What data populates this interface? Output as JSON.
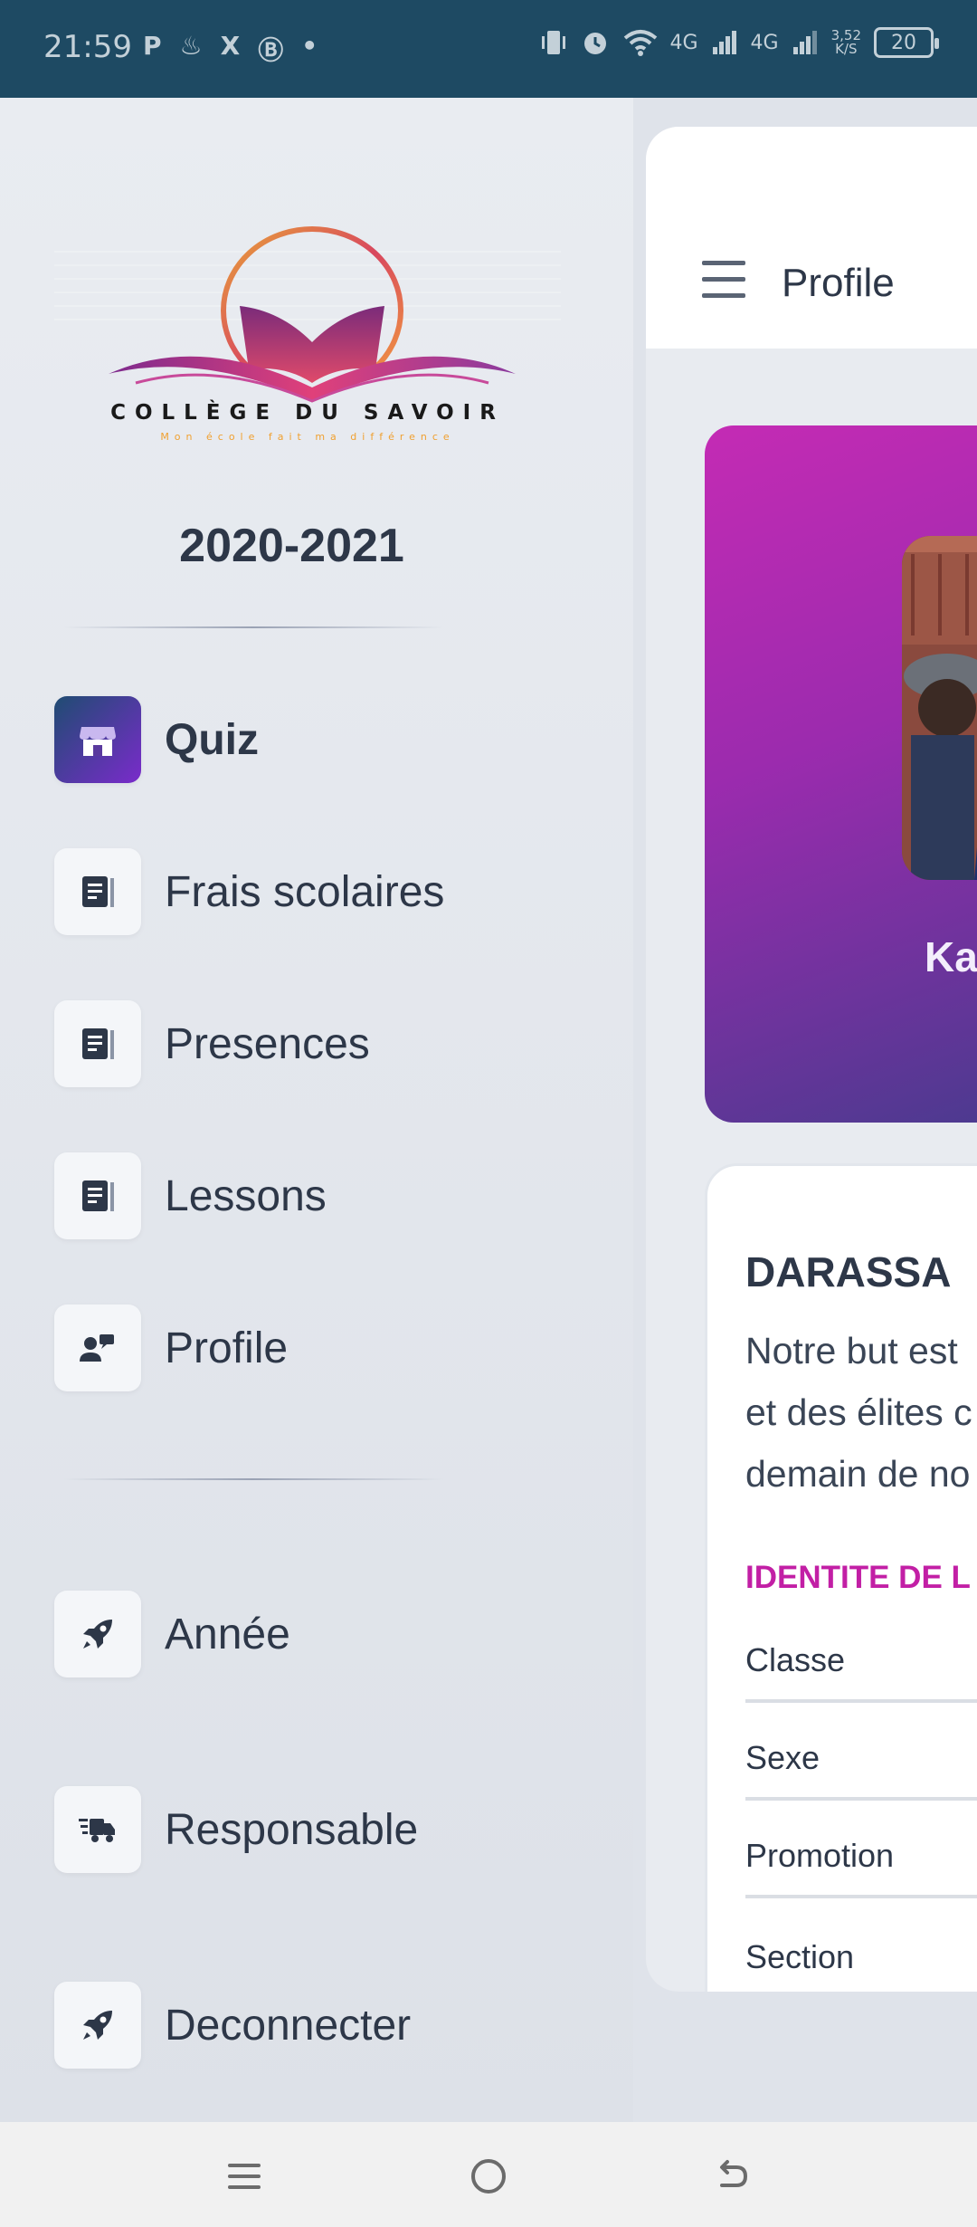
{
  "status_bar": {
    "time": "21:59",
    "left_icons": [
      "P",
      "♨",
      "X",
      "Ⓑ",
      "•"
    ],
    "network_left": "4G",
    "network_right": "4G",
    "speed_value": "3,52",
    "speed_unit": "K/S",
    "battery": "20"
  },
  "sidebar": {
    "logo_title": "COLLÈGE DU SAVOIR",
    "logo_tagline": "Mon école fait ma différence",
    "year": "2020-2021",
    "items": [
      {
        "label": "Quiz",
        "icon": "store-icon",
        "active": true
      },
      {
        "label": "Frais scolaires",
        "icon": "receipt-icon",
        "active": false
      },
      {
        "label": "Presences",
        "icon": "receipt-icon",
        "active": false
      },
      {
        "label": "Lessons",
        "icon": "receipt-icon",
        "active": false
      },
      {
        "label": "Profile",
        "icon": "user-comment-icon",
        "active": false
      },
      {
        "label": "Année",
        "icon": "rocket-icon",
        "active": false
      },
      {
        "label": "Responsable",
        "icon": "delivery-truck-icon",
        "active": false
      },
      {
        "label": "Deconnecter",
        "icon": "rocket-icon",
        "active": false
      }
    ]
  },
  "main": {
    "header_title": "Profile",
    "profile_name": "Ka",
    "info_title": "DARASSA",
    "info_text_lines": [
      "Notre but est",
      "et des élites c",
      "demain de no"
    ],
    "identity_heading": "IDENTITE DE L",
    "fields": [
      "Classe",
      "Sexe",
      "Promotion",
      "Section"
    ]
  },
  "colors": {
    "status_bar_bg": "#1e4a63",
    "accent_magenta": "#c21fa5",
    "active_icon_gradient_start": "#1f4c72",
    "active_icon_gradient_end": "#7a2bcb"
  }
}
